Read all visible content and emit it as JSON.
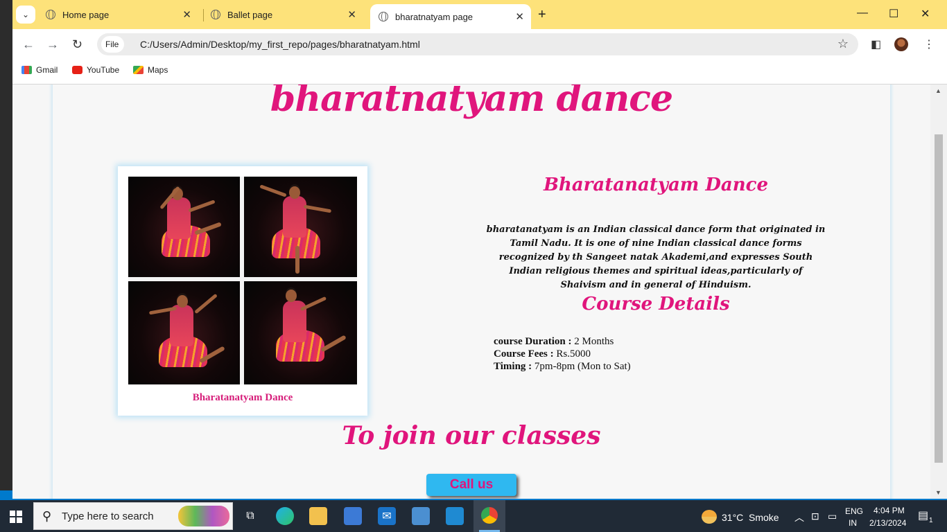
{
  "browser": {
    "tabs": [
      {
        "title": "Home page",
        "active": false
      },
      {
        "title": "Ballet page",
        "active": false
      },
      {
        "title": "bharatnatyam page",
        "active": true
      }
    ],
    "address": {
      "scheme_label": "File",
      "url": "C:/Users/Admin/Desktop/my_first_repo/pages/bharatnatyam.html"
    },
    "bookmarks": [
      {
        "label": "Gmail",
        "icon": "gmail-icon"
      },
      {
        "label": "YouTube",
        "icon": "youtube-icon"
      },
      {
        "label": "Maps",
        "icon": "maps-icon"
      }
    ]
  },
  "page": {
    "main_title": "bharatnatyam dance",
    "figure_caption": "Bharatanatyam Dance",
    "info_title": "Bharatanatyam Dance",
    "description": "bharatanatyam is an Indian classical dance form that originated in Tamil Nadu. It is one of nine Indian classical dance forms recognized by th Sangeet natak Akademi,and expresses South Indian religious themes and spiritual ideas,particularly of Shaivism and in general of Hinduism.",
    "course_title": "Course Details",
    "course": [
      {
        "label": "course Duration :",
        "value": " 2 Months"
      },
      {
        "label": "Course Fees :",
        "value": " Rs.5000"
      },
      {
        "label": "Timing :",
        "value": " 7pm-8pm (Mon to Sat)"
      }
    ],
    "join_title": "To join our classes",
    "call_button": "Call us"
  },
  "taskbar": {
    "search_placeholder": "Type here to search",
    "weather_temp": "31°C",
    "weather_desc": "Smoke",
    "lang_top": "ENG",
    "lang_bottom": "IN",
    "time": "4:04 PM",
    "date": "2/13/2024",
    "notification_count": "1"
  },
  "colors": {
    "accent_pink": "#e0157c",
    "tabbar_yellow": "#fde27a",
    "call_button_blue": "#2fb8f0"
  }
}
